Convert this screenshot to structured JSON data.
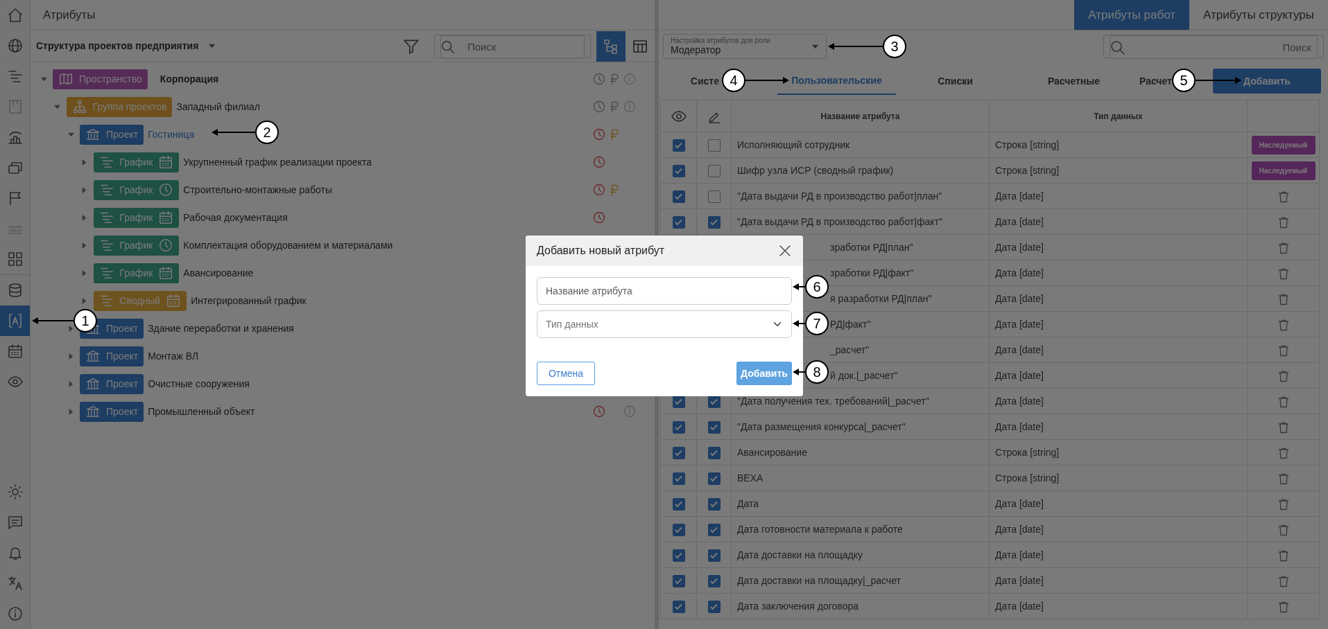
{
  "sidebar": {
    "sections": [
      {
        "items": [
          {
            "kind": "home",
            "selected": false
          },
          {
            "kind": "globe",
            "selected": false
          },
          {
            "kind": "bars",
            "selected": false
          },
          {
            "kind": "board",
            "selected": false
          },
          {
            "kind": "chart",
            "selected": false
          },
          {
            "kind": "windows",
            "selected": false
          },
          {
            "kind": "flag",
            "selected": false
          },
          {
            "kind": "stripes",
            "selected": false
          },
          {
            "kind": "grid",
            "selected": false
          }
        ]
      },
      {
        "items": [
          {
            "kind": "database",
            "selected": false
          },
          {
            "kind": "bracket",
            "selected": true
          },
          {
            "kind": "calendar",
            "selected": false
          },
          {
            "kind": "eye",
            "selected": false
          }
        ]
      },
      {
        "items": [
          {
            "kind": "sun",
            "selected": false
          },
          {
            "kind": "chat",
            "selected": false
          },
          {
            "kind": "bell",
            "selected": false
          },
          {
            "kind": "translate",
            "selected": false
          },
          {
            "kind": "info",
            "selected": false
          }
        ]
      }
    ]
  },
  "left_panel": {
    "title": "Атрибуты",
    "structure_select": "Структура проектов предприятия",
    "search": {
      "placeholder": "Поиск"
    },
    "views": [
      {
        "kind": "hierarchy",
        "selected": true
      },
      {
        "kind": "table",
        "selected": false
      }
    ],
    "tree": [
      {
        "label": "Корпорация",
        "selected": false,
        "expanded": true,
        "badge": {
          "kind": "space",
          "label": "Пространство"
        },
        "indicators": [
          {
            "kind": "clock",
            "alert": false
          },
          {
            "kind": "ruble",
            "alert": false
          },
          {
            "kind": "info"
          }
        ],
        "children": [
          {
            "label": "Западный филиал",
            "selected": false,
            "expanded": true,
            "badge": {
              "kind": "group",
              "label": "Группа проектов"
            },
            "indicators": [
              {
                "kind": "clock",
                "alert": false
              },
              {
                "kind": "ruble",
                "alert": false
              },
              {
                "kind": "info"
              }
            ],
            "children": [
              {
                "label": "Гостиница",
                "selected": true,
                "expanded": true,
                "badge": {
                  "kind": "project",
                  "label": "Проект"
                },
                "indicators": [
                  {
                    "kind": "clock",
                    "alert": true
                  },
                  {
                    "kind": "ruble",
                    "alert": true
                  }
                ],
                "children": [
                  {
                    "label": "Укрупненный график реализации проекта",
                    "selected": false,
                    "expanded": false,
                    "badge": {
                      "kind": "schedule-calendar",
                      "label": "График"
                    },
                    "indicators": [
                      {
                        "kind": "clock",
                        "alert": true
                      }
                    ]
                  },
                  {
                    "label": "Строительно-монтажные работы",
                    "selected": false,
                    "expanded": false,
                    "badge": {
                      "kind": "schedule-clock",
                      "label": "График"
                    },
                    "indicators": [
                      {
                        "kind": "clock",
                        "alert": true
                      },
                      {
                        "kind": "ruble",
                        "alert": true
                      }
                    ]
                  },
                  {
                    "label": "Рабочая документация",
                    "selected": false,
                    "expanded": false,
                    "badge": {
                      "kind": "schedule-calendar",
                      "label": "График"
                    },
                    "indicators": [
                      {
                        "kind": "clock",
                        "alert": true
                      }
                    ]
                  },
                  {
                    "label": "Комплектация оборудованием и материалами",
                    "selected": false,
                    "expanded": false,
                    "badge": {
                      "kind": "schedule-clock",
                      "label": "График"
                    }
                  },
                  {
                    "label": "Авансирование",
                    "selected": false,
                    "expanded": false,
                    "badge": {
                      "kind": "schedule-calendar",
                      "label": "График"
                    }
                  },
                  {
                    "label": "Интегрированный график",
                    "selected": false,
                    "expanded": false,
                    "badge": {
                      "kind": "summary",
                      "label": "Сводный"
                    }
                  }
                ]
              },
              {
                "label": "Здание переработки и хранения",
                "selected": false,
                "expanded": false,
                "badge": {
                  "kind": "project",
                  "label": "Проект"
                }
              },
              {
                "label": "Монтаж ВЛ",
                "selected": false,
                "expanded": false,
                "badge": {
                  "kind": "project",
                  "label": "Проект"
                }
              },
              {
                "label": "Очистные сооружения",
                "selected": false,
                "expanded": false,
                "badge": {
                  "kind": "project",
                  "label": "Проект"
                }
              },
              {
                "label": "Промышленный объект",
                "selected": false,
                "expanded": false,
                "badge": {
                  "kind": "project",
                  "label": "Проект"
                },
                "indicators": [
                  {
                    "kind": "clock",
                    "alert": true
                  },
                  {
                    "kind": "info"
                  }
                ]
              }
            ]
          }
        ]
      }
    ]
  },
  "right_panel": {
    "tabs": [
      {
        "label": "Атрибуты работ",
        "selected": true
      },
      {
        "label": "Атрибуты структуры",
        "selected": false
      }
    ],
    "role_select": {
      "label": "Настройка атрибутов для роли",
      "value": "Модератор"
    },
    "search": {
      "placeholder": "Поиск"
    },
    "category_tabs": [
      {
        "label": "Систе",
        "selected": false
      },
      {
        "label": "Пользовательские",
        "selected": true
      },
      {
        "label": "Списки",
        "selected": false
      },
      {
        "label": "Расчетные",
        "selected": false
      },
      {
        "label": "Расчет",
        "selected": false
      }
    ],
    "add_button": "Добавить",
    "table": {
      "columns": [
        {
          "kind": "eye"
        },
        {
          "kind": "pencil"
        },
        {
          "label": "Название атрибута"
        },
        {
          "label": "Тип данных"
        }
      ],
      "rows": [
        {
          "covered": false,
          "visible": true,
          "editable": false,
          "name": "Исполняющий сотрудник",
          "type": "Строка [string]",
          "action": {
            "kind": "inherited",
            "label": "Наследуемый"
          }
        },
        {
          "covered": false,
          "visible": true,
          "editable": false,
          "name": "Шифр узла ИСР (сводный график)",
          "type": "Строка [string]",
          "action": {
            "kind": "inherited",
            "label": "Наследуемый"
          }
        },
        {
          "covered": false,
          "visible": true,
          "editable": false,
          "name": "\"Дата выдачи РД в производство работ|план\"",
          "type": "Дата [date]",
          "action": {
            "kind": "delete"
          }
        },
        {
          "covered": false,
          "visible": true,
          "editable": true,
          "name": "\"Дата выдачи РД в производство работ|факт\"",
          "type": "Дата [date]",
          "action": {
            "kind": "delete"
          }
        },
        {
          "covered": true,
          "name": "зработки РД|план\"",
          "type": "Дата [date]",
          "action": {
            "kind": "delete"
          }
        },
        {
          "covered": true,
          "name": "зработки РД|факт\"",
          "type": "Дата [date]",
          "action": {
            "kind": "delete"
          }
        },
        {
          "covered": true,
          "name": "я разработки РД|план\"",
          "type": "Дата [date]",
          "action": {
            "kind": "delete"
          }
        },
        {
          "covered": true,
          "name": "РД|факт\"",
          "type": "Дата [date]",
          "action": {
            "kind": "delete"
          }
        },
        {
          "covered": true,
          "name": "_расчет\"",
          "type": "Дата [date]",
          "action": {
            "kind": "delete"
          }
        },
        {
          "covered": true,
          "name": "й док.|_расчет\"",
          "type": "Дата [date]",
          "action": {
            "kind": "delete"
          }
        },
        {
          "covered": false,
          "visible": true,
          "editable": true,
          "name": "\"Дата получения тех. требований|_расчет\"",
          "type": "Дата [date]",
          "action": {
            "kind": "delete"
          }
        },
        {
          "covered": false,
          "visible": true,
          "editable": true,
          "name": "\"Дата размещения конкурса|_расчет\"",
          "type": "Дата [date]",
          "action": {
            "kind": "delete"
          }
        },
        {
          "covered": false,
          "visible": true,
          "editable": true,
          "name": "Авансирование",
          "type": "Строка [string]",
          "action": {
            "kind": "delete"
          }
        },
        {
          "covered": false,
          "visible": true,
          "editable": true,
          "name": "ВЕХА",
          "type": "Строка [string]",
          "action": {
            "kind": "delete"
          }
        },
        {
          "covered": false,
          "visible": true,
          "editable": true,
          "name": "Дата",
          "type": "Дата [date]",
          "action": {
            "kind": "delete"
          }
        },
        {
          "covered": false,
          "visible": true,
          "editable": true,
          "name": "Дата готовности материала к работе",
          "type": "Дата [date]",
          "action": {
            "kind": "delete"
          }
        },
        {
          "covered": false,
          "visible": true,
          "editable": true,
          "name": "Дата доставки на площадку",
          "type": "Дата [date]",
          "action": {
            "kind": "delete"
          }
        },
        {
          "covered": false,
          "visible": true,
          "editable": true,
          "name": "Дата доставки на площадку|_расчет",
          "type": "Дата [date]",
          "action": {
            "kind": "delete"
          }
        },
        {
          "covered": false,
          "visible": true,
          "editable": true,
          "name": "Дата заключения договора",
          "type": "Дата [date]",
          "action": {
            "kind": "delete"
          }
        }
      ]
    }
  },
  "modal": {
    "title": "Добавить новый атрибут",
    "name_field": {
      "placeholder": "Название атрибута"
    },
    "type_select": {
      "placeholder": "Тип данных"
    },
    "cancel": "Отмена",
    "submit": {
      "label": "Добавить",
      "disabled": true
    }
  },
  "callouts": [
    {
      "label": "1"
    },
    {
      "label": "2"
    },
    {
      "label": "3"
    },
    {
      "label": "4"
    },
    {
      "label": "5"
    },
    {
      "label": "6"
    },
    {
      "label": "7"
    },
    {
      "label": "8"
    }
  ]
}
